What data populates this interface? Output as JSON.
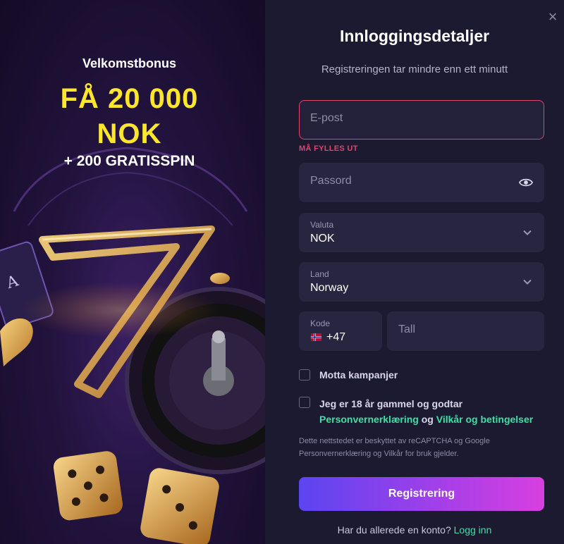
{
  "promo": {
    "kicker": "Velkomstbonus",
    "amount_line1": "FÅ 20 000",
    "amount_line2": "NOK",
    "spins": "+ 200 GRATISSPIN"
  },
  "form": {
    "close_label": "×",
    "title": "Innloggingsdetaljer",
    "subtitle": "Registreringen tar mindre enn ett minutt",
    "email": {
      "placeholder": "E-post",
      "error": "MÅ FYLLES UT"
    },
    "password": {
      "placeholder": "Passord"
    },
    "currency": {
      "label": "Valuta",
      "value": "NOK"
    },
    "country": {
      "label": "Land",
      "value": "Norway"
    },
    "code": {
      "label": "Kode",
      "value": "+47"
    },
    "phone": {
      "placeholder": "Tall"
    },
    "promo_checkbox": "Motta kampanjer",
    "terms": {
      "text_prefix": "Jeg er 18 år gammel og godtar",
      "privacy_link": "Personvernerklæring",
      "and": "og",
      "terms_link": "Vilkår og betingelser"
    },
    "legal": "Dette nettstedet er beskyttet av reCAPTCHA og Google Personvernerklæring og Vilkår for bruk gjelder.",
    "register_button": "Registrering",
    "login_prompt": "Har du allerede en konto?",
    "login_link": "Logg inn"
  },
  "colors": {
    "panel_bg": "#1c1a31",
    "field_bg": "#27253f",
    "error": "#e2436a",
    "accent_yellow": "#fde62b",
    "link_green": "#3fe0a4",
    "button_gradient_start": "#5b45f0",
    "button_gradient_end": "#d83fe0"
  }
}
